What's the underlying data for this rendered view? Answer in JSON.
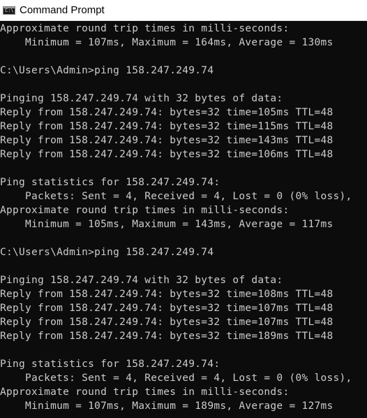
{
  "window": {
    "title": "Command Prompt",
    "icon": "cmd-console-icon",
    "icon_glyph": "C:\\"
  },
  "colors": {
    "console_background": "#0c0c0c",
    "console_text": "#cccccc",
    "titlebar_background": "#ffffff"
  },
  "console": {
    "lines": [
      "Approximate round trip times in milli-seconds:",
      "    Minimum = 107ms, Maximum = 164ms, Average = 130ms",
      "",
      "C:\\Users\\Admin>ping 158.247.249.74",
      "",
      "Pinging 158.247.249.74 with 32 bytes of data:",
      "Reply from 158.247.249.74: bytes=32 time=105ms TTL=48",
      "Reply from 158.247.249.74: bytes=32 time=115ms TTL=48",
      "Reply from 158.247.249.74: bytes=32 time=143ms TTL=48",
      "Reply from 158.247.249.74: bytes=32 time=106ms TTL=48",
      "",
      "Ping statistics for 158.247.249.74:",
      "    Packets: Sent = 4, Received = 4, Lost = 0 (0% loss),",
      "Approximate round trip times in milli-seconds:",
      "    Minimum = 105ms, Maximum = 143ms, Average = 117ms",
      "",
      "C:\\Users\\Admin>ping 158.247.249.74",
      "",
      "Pinging 158.247.249.74 with 32 bytes of data:",
      "Reply from 158.247.249.74: bytes=32 time=108ms TTL=48",
      "Reply from 158.247.249.74: bytes=32 time=107ms TTL=48",
      "Reply from 158.247.249.74: bytes=32 time=107ms TTL=48",
      "Reply from 158.247.249.74: bytes=32 time=189ms TTL=48",
      "",
      "Ping statistics for 158.247.249.74:",
      "    Packets: Sent = 4, Received = 4, Lost = 0 (0% loss),",
      "Approximate round trip times in milli-seconds:",
      "    Minimum = 107ms, Maximum = 189ms, Average = 127ms"
    ]
  }
}
